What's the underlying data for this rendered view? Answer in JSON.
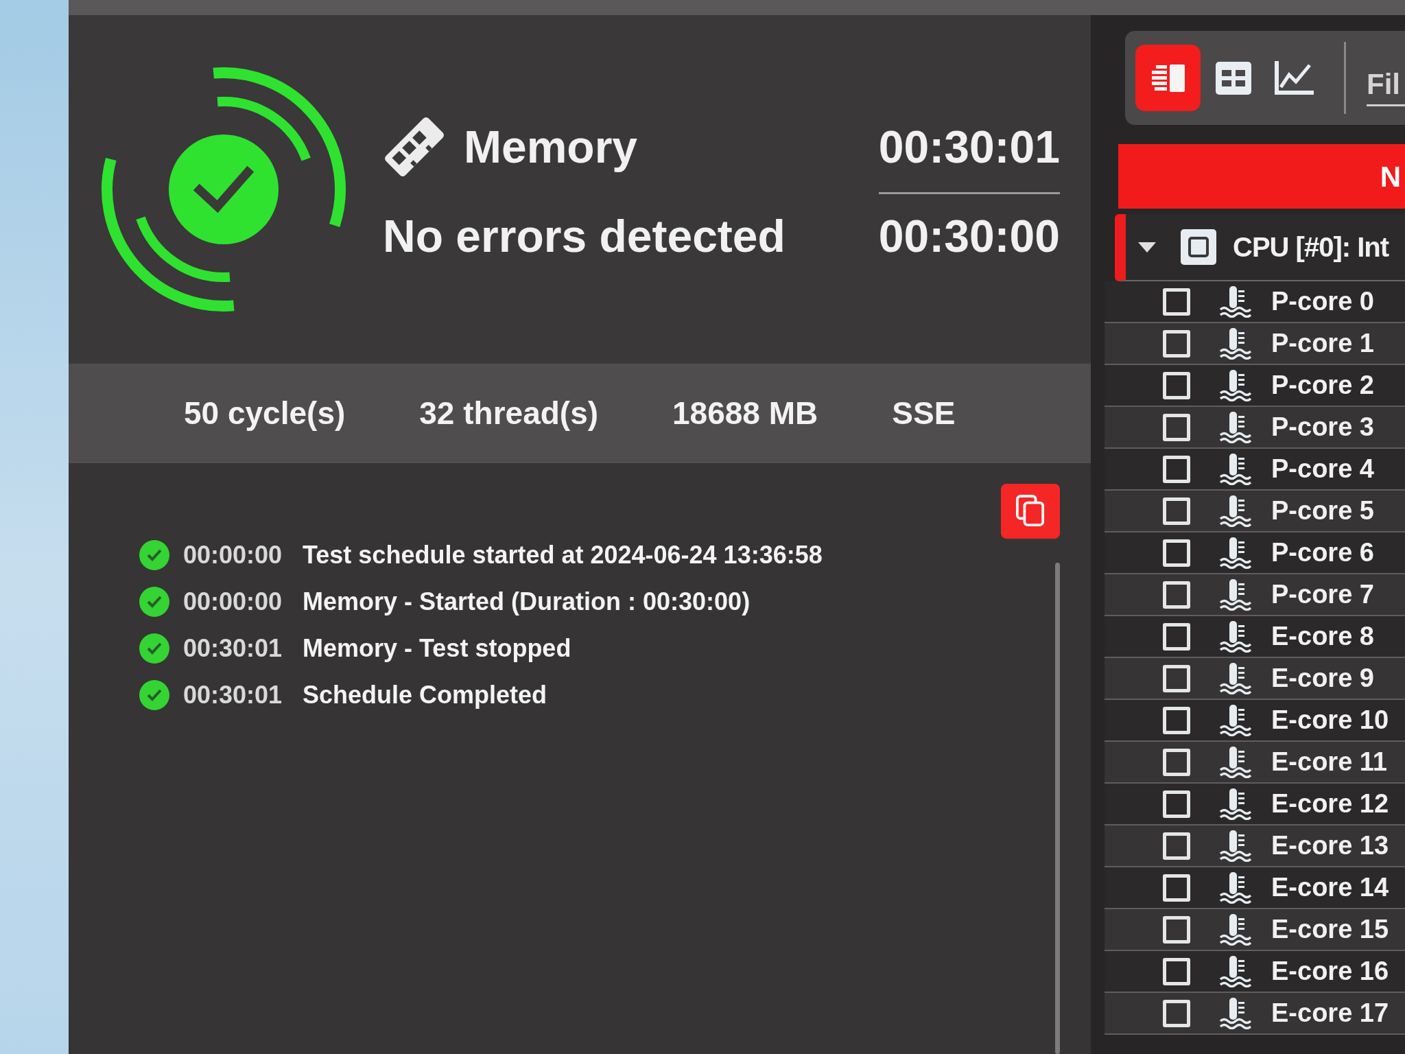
{
  "status": {
    "passed": true,
    "test": "Memory",
    "message": "No errors detected",
    "elapsed": "00:30:01",
    "duration": "00:30:00"
  },
  "stats": [
    "50 cycle(s)",
    "32 thread(s)",
    "18688 MB",
    "SSE"
  ],
  "log": [
    {
      "time": "00:00:00",
      "message": "Test schedule started at 2024-06-24 13:36:58"
    },
    {
      "time": "00:00:00",
      "message": "Memory - Started (Duration : 00:30:00)"
    },
    {
      "time": "00:30:01",
      "message": "Memory - Test stopped"
    },
    {
      "time": "00:30:01",
      "message": "Schedule Completed"
    }
  ],
  "sensor_panel": {
    "views": [
      {
        "kind": "list",
        "selected": true
      },
      {
        "kind": "grid",
        "selected": false
      },
      {
        "kind": "chart",
        "selected": false
      }
    ],
    "filter": {
      "placeholder": "Fil"
    },
    "banner": "N",
    "device": {
      "label": "CPU [#0]: Int",
      "expanded": true,
      "children": [
        {
          "label": "P-core 0",
          "checked": false
        },
        {
          "label": "P-core 1",
          "checked": false
        },
        {
          "label": "P-core 2",
          "checked": false
        },
        {
          "label": "P-core 3",
          "checked": false
        },
        {
          "label": "P-core 4",
          "checked": false
        },
        {
          "label": "P-core 5",
          "checked": false
        },
        {
          "label": "P-core 6",
          "checked": false
        },
        {
          "label": "P-core 7",
          "checked": false
        },
        {
          "label": "E-core 8",
          "checked": false
        },
        {
          "label": "E-core 9",
          "checked": false
        },
        {
          "label": "E-core 10",
          "checked": false
        },
        {
          "label": "E-core 11",
          "checked": false
        },
        {
          "label": "E-core 12",
          "checked": false
        },
        {
          "label": "E-core 13",
          "checked": false
        },
        {
          "label": "E-core 14",
          "checked": false
        },
        {
          "label": "E-core 15",
          "checked": false
        },
        {
          "label": "E-core 16",
          "checked": false
        },
        {
          "label": "E-core 17",
          "checked": false
        }
      ]
    }
  }
}
